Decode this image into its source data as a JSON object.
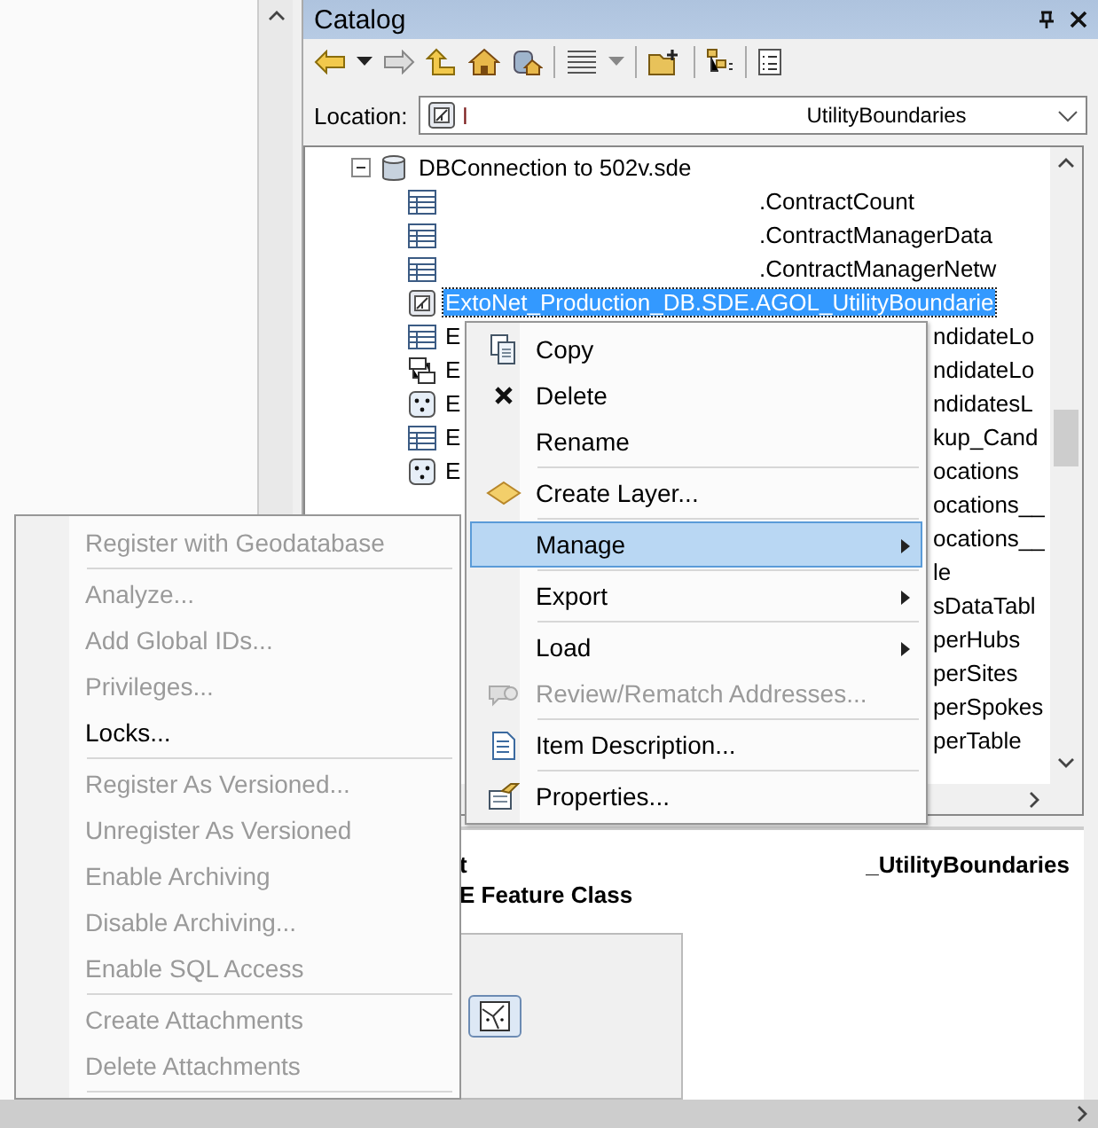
{
  "catalog": {
    "title": "Catalog"
  },
  "location": {
    "label": "Location:",
    "value_start": "l",
    "value_end": "UtilityBoundaries"
  },
  "tree": {
    "label": "DBConnection to 502v.sde",
    "expanded": true,
    "children": [
      {
        "kind": "table",
        "redacted": true,
        "tail": ".ContractCount",
        "selected": false
      },
      {
        "kind": "table",
        "redacted": true,
        "tail": ".ContractManagerData",
        "selected": false
      },
      {
        "kind": "table",
        "redacted": true,
        "tail": ".ContractManagerNetw",
        "selected": false
      },
      {
        "kind": "feature_class",
        "label": "ExtoNet_Production_DB.SDE.AGOL_UtilityBoundarie",
        "selected": true
      },
      {
        "kind": "table",
        "label": "E",
        "tail": "ndidateLo",
        "selected": false
      },
      {
        "kind": "relationship",
        "label": "E",
        "tail": "ndidateLo",
        "selected": false
      },
      {
        "kind": "points",
        "label": "E",
        "tail": "ndidatesL",
        "selected": false
      },
      {
        "kind": "table",
        "label": "E",
        "tail": "kup_Cand",
        "selected": false
      },
      {
        "kind": "points",
        "label": "E",
        "tail": "ocations",
        "selected": false
      },
      {
        "tail": "ocations__",
        "selected": false
      },
      {
        "tail": "ocations__",
        "selected": false
      },
      {
        "tail": "le",
        "selected": false
      },
      {
        "tail": "sDataTabl",
        "selected": false
      },
      {
        "tail": "perHubs",
        "selected": false
      },
      {
        "tail": "perSites",
        "selected": false
      },
      {
        "tail": "perSpokes",
        "selected": false
      },
      {
        "tail": "perTable",
        "selected": false
      }
    ]
  },
  "preview": {
    "title_start": "t",
    "title_end": "_UtilityBoundaries",
    "subtitle": "E Feature Class"
  },
  "context_menu": [
    {
      "kind": "item",
      "label": "Copy",
      "disabled": false,
      "selected": false,
      "submenu": false
    },
    {
      "kind": "item",
      "label": "Delete",
      "disabled": false,
      "selected": false,
      "submenu": false
    },
    {
      "kind": "item",
      "label": "Rename",
      "disabled": false,
      "selected": false,
      "submenu": false
    },
    {
      "kind": "separator"
    },
    {
      "kind": "item",
      "label": "Create Layer...",
      "disabled": false,
      "selected": false,
      "submenu": false
    },
    {
      "kind": "separator"
    },
    {
      "kind": "item",
      "label": "Manage",
      "disabled": false,
      "selected": true,
      "submenu": true
    },
    {
      "kind": "separator"
    },
    {
      "kind": "item",
      "label": "Export",
      "disabled": false,
      "selected": false,
      "submenu": true
    },
    {
      "kind": "separator"
    },
    {
      "kind": "item",
      "label": "Load",
      "disabled": false,
      "selected": false,
      "submenu": true
    },
    {
      "kind": "item",
      "label": "Review/Rematch Addresses...",
      "disabled": true,
      "selected": false,
      "submenu": false
    },
    {
      "kind": "separator"
    },
    {
      "kind": "item",
      "label": "Item Description...",
      "disabled": false,
      "selected": false,
      "submenu": false
    },
    {
      "kind": "separator"
    },
    {
      "kind": "item",
      "label": "Properties...",
      "disabled": false,
      "selected": false,
      "submenu": false
    }
  ],
  "manage_submenu": [
    {
      "kind": "item",
      "label": "Register with Geodatabase",
      "disabled": true
    },
    {
      "kind": "separator"
    },
    {
      "kind": "item",
      "label": "Analyze...",
      "disabled": true
    },
    {
      "kind": "item",
      "label": "Add Global IDs...",
      "disabled": true
    },
    {
      "kind": "item",
      "label": "Privileges...",
      "disabled": true
    },
    {
      "kind": "item",
      "label": "Locks...",
      "disabled": false
    },
    {
      "kind": "separator"
    },
    {
      "kind": "item",
      "label": "Register As Versioned...",
      "disabled": true
    },
    {
      "kind": "item",
      "label": "Unregister As Versioned",
      "disabled": true
    },
    {
      "kind": "item",
      "label": "Enable Archiving",
      "disabled": true
    },
    {
      "kind": "item",
      "label": "Disable Archiving...",
      "disabled": true
    },
    {
      "kind": "item",
      "label": "Enable SQL Access",
      "disabled": true
    },
    {
      "kind": "separator"
    },
    {
      "kind": "item",
      "label": "Create Attachments",
      "disabled": true
    },
    {
      "kind": "item",
      "label": "Delete Attachments",
      "disabled": true
    },
    {
      "kind": "separator"
    }
  ]
}
